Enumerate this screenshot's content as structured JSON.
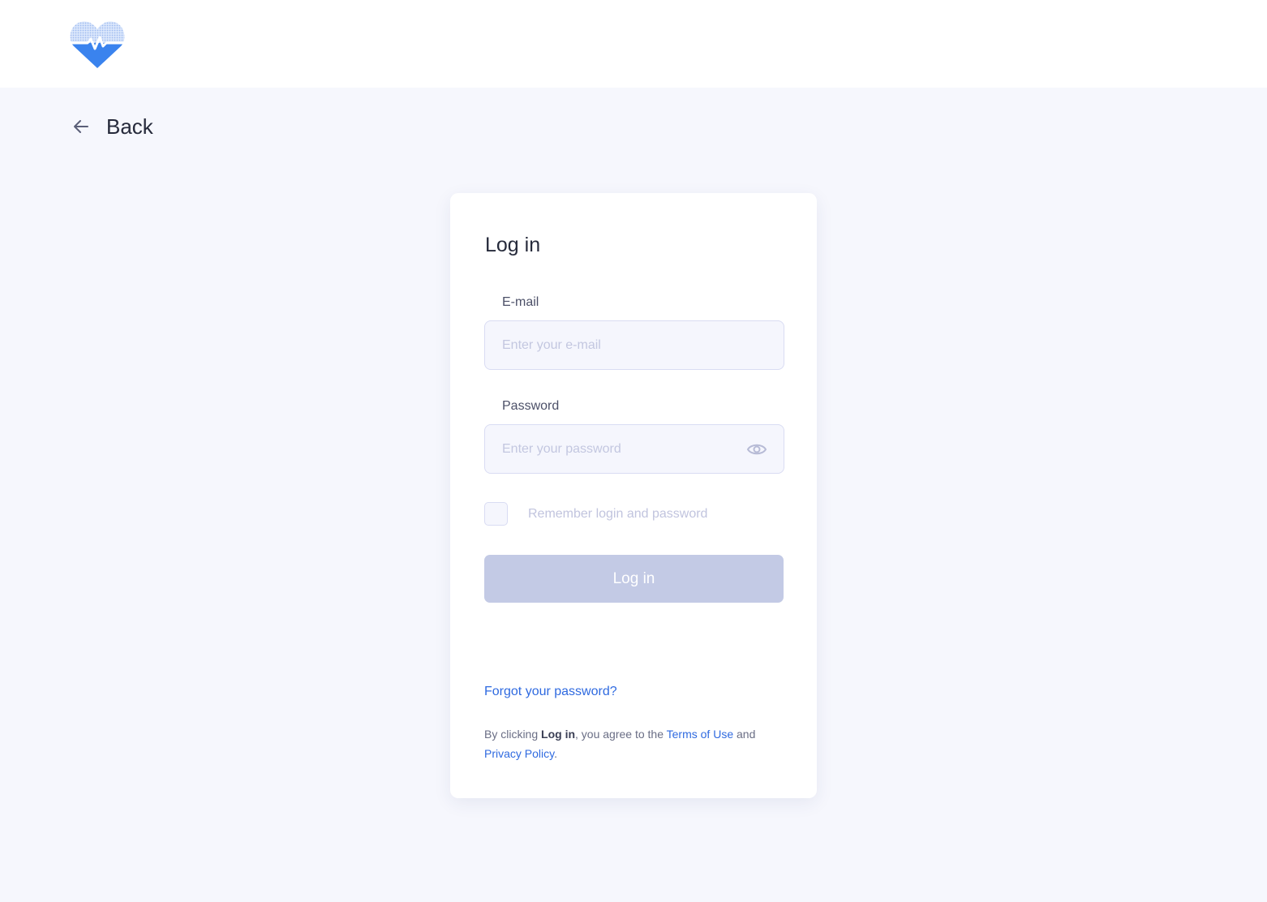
{
  "header": {
    "logo_icon": "heart-pulse-logo-icon",
    "logo_colors": {
      "light": "#b9cff5",
      "dark": "#3a83ee"
    }
  },
  "nav": {
    "back_icon": "arrow-left-icon",
    "back_label": "Back"
  },
  "login_card": {
    "title": "Log in",
    "email": {
      "label": "E-mail",
      "placeholder": "Enter your e-mail",
      "value": ""
    },
    "password": {
      "label": "Password",
      "placeholder": "Enter your password",
      "value": "",
      "toggle_icon": "eye-icon"
    },
    "remember": {
      "label": "Remember login and password",
      "checked": false
    },
    "submit_label": "Log in",
    "forgot_link": "Forgot your password?",
    "legal": {
      "prefix": "By clicking ",
      "action": "Log in",
      "middle": ", you agree to the ",
      "terms_link": "Terms of Use",
      "and": " and",
      "privacy_link": "Privacy Policy",
      "suffix": "."
    }
  },
  "colors": {
    "background": "#f6f7fd",
    "accent_link": "#2f6ae0",
    "button_disabled": "#c3cae5",
    "input_border": "#d9dcf3"
  }
}
